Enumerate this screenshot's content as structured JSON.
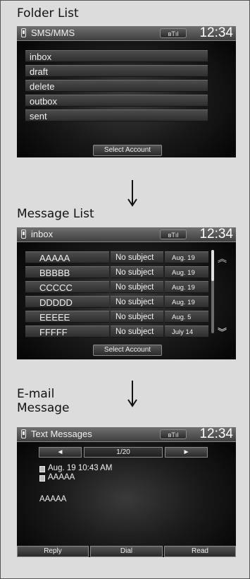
{
  "sections": {
    "folder": "Folder List",
    "message": "Message List",
    "email_line1": "E-mail",
    "email_line2": "Message"
  },
  "folder_screen": {
    "title": "SMS/MMS",
    "signal": "ʙTıl",
    "clock": "12:34",
    "folders": [
      "inbox",
      "draft",
      "delete",
      "outbox",
      "sent"
    ],
    "select_account": "Select Account"
  },
  "message_screen": {
    "title": "inbox",
    "signal": "ʙTıl",
    "clock": "12:34",
    "messages": [
      {
        "name": "AAAAA",
        "subject": "No subject",
        "date": "Aug. 19"
      },
      {
        "name": "BBBBB",
        "subject": "No subject",
        "date": "Aug. 19"
      },
      {
        "name": "CCCCC",
        "subject": "No subject",
        "date": "Aug. 19"
      },
      {
        "name": "DDDDD",
        "subject": "No subject",
        "date": "Aug. 19"
      },
      {
        "name": "EEEEE",
        "subject": "No subject",
        "date": "Aug. 5"
      },
      {
        "name": "FFFFF",
        "subject": "No subject",
        "date": "July 14"
      }
    ],
    "select_account": "Select Account"
  },
  "detail_screen": {
    "title": "Text Messages",
    "signal": "ʙTıl",
    "clock": "12:34",
    "prev": "◄",
    "next": "►",
    "page": "1/20",
    "datetime": "Aug. 19 10:43 AM",
    "sender": "AAAAA",
    "body": "AAAAA",
    "actions": [
      "Reply",
      "Dial",
      "Read"
    ]
  },
  "colors": {
    "panel": "#dcdcdc",
    "screen": "#000000",
    "statusbar": "#5a5a5a",
    "text": "#f2f2f2"
  }
}
